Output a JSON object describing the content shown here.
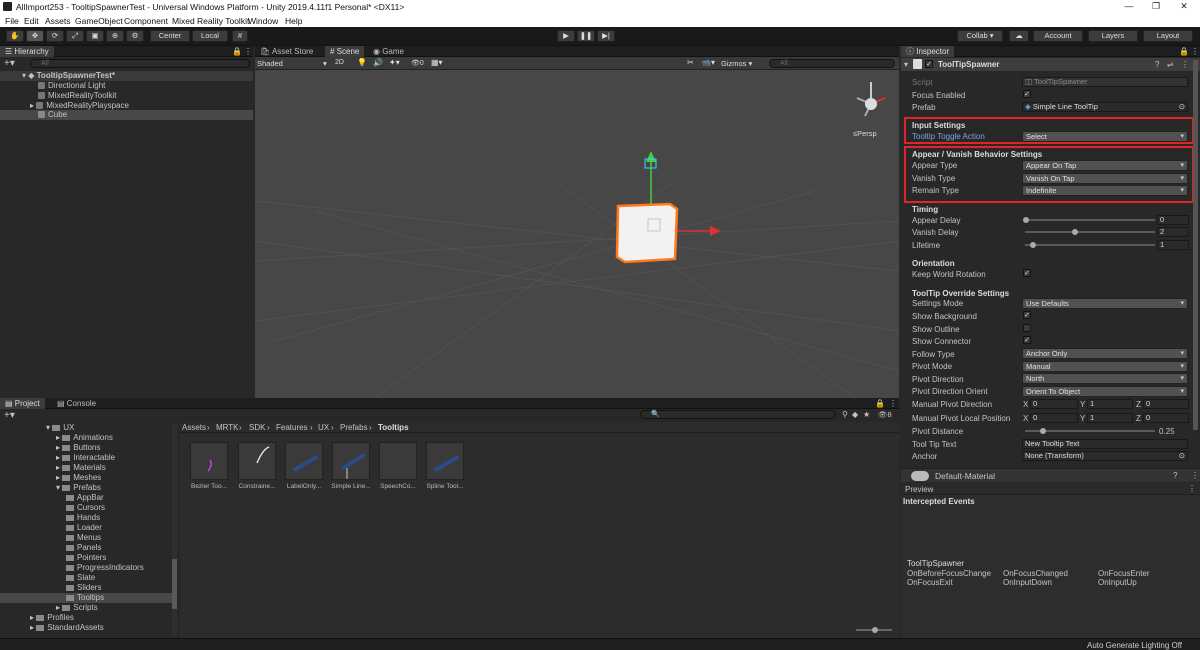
{
  "window": {
    "title": "AllImport253 - TooltipSpawnerTest - Universal Windows Platform - Unity 2019.4.11f1 Personal* <DX11>",
    "controls": [
      "—",
      "❐",
      "✕"
    ]
  },
  "menu": [
    "File",
    "Edit",
    "Assets",
    "GameObject",
    "Component",
    "Mixed Reality Toolkit",
    "Window",
    "Help"
  ],
  "toolbar": {
    "pivot_center": "Center",
    "pivot_local": "Local",
    "collab": "Collab ▾",
    "account": "Account",
    "layers": "Layers",
    "layout": "Layout"
  },
  "hierarchy": {
    "tab": "Hierarchy",
    "search_placeholder": "All",
    "scene": "TooltipSpawnerTest*",
    "items": [
      "Directional Light",
      "MixedRealityToolkit",
      "MixedRealityPlayspace",
      "Cube"
    ]
  },
  "scene_tabs": [
    "Asset Store",
    "Scene",
    "Game"
  ],
  "scene_toolbar": {
    "shading": "Shaded",
    "mode2d": "2D",
    "fx_count": "0",
    "gizmos": "Gizmos",
    "search_placeholder": "All",
    "persp": "≤Persp"
  },
  "project": {
    "tabs": [
      "Project",
      "Console"
    ],
    "breadcrumb": [
      "Assets",
      "MRTK",
      "SDK",
      "Features",
      "UX",
      "Prefabs",
      "Tooltips"
    ],
    "hidden_count": "8",
    "tree": [
      {
        "name": "UX",
        "indent": 0
      },
      {
        "name": "Animations",
        "indent": 1
      },
      {
        "name": "Buttons",
        "indent": 1
      },
      {
        "name": "Interactable",
        "indent": 1
      },
      {
        "name": "Materials",
        "indent": 1
      },
      {
        "name": "Meshes",
        "indent": 1
      },
      {
        "name": "Prefabs",
        "indent": 1
      },
      {
        "name": "AppBar",
        "indent": 2
      },
      {
        "name": "Cursors",
        "indent": 2
      },
      {
        "name": "Hands",
        "indent": 2
      },
      {
        "name": "Loader",
        "indent": 2
      },
      {
        "name": "Menus",
        "indent": 2
      },
      {
        "name": "Panels",
        "indent": 2
      },
      {
        "name": "Pointers",
        "indent": 2
      },
      {
        "name": "ProgressIndicators",
        "indent": 2
      },
      {
        "name": "Slate",
        "indent": 2
      },
      {
        "name": "Sliders",
        "indent": 2
      },
      {
        "name": "Tooltips",
        "indent": 2
      },
      {
        "name": "Scripts",
        "indent": 1
      },
      {
        "name": "Profiles",
        "indent": -1
      },
      {
        "name": "StandardAssets",
        "indent": -1
      }
    ],
    "assets": [
      "Bezier Too...",
      "Constraine...",
      "LabelOnly...",
      "Simple Line...",
      "SpeechCo...",
      "Spline Tool..."
    ]
  },
  "inspector": {
    "tab": "Inspector",
    "component": "ToolTipSpawner",
    "script_label": "Script",
    "script_value": "ToolTipSpawner",
    "focus_enabled": "Focus Enabled",
    "prefab_label": "Prefab",
    "prefab_value": "Simple Line ToolTip",
    "input_settings": "Input Settings",
    "toggle_action_label": "Tooltip Toggle Action",
    "toggle_action_value": "Select",
    "appear_vanish": "Appear / Vanish Behavior Settings",
    "appear_type_label": "Appear Type",
    "appear_type_value": "Appear On Tap",
    "vanish_type_label": "Vanish Type",
    "vanish_type_value": "Vanish On Tap",
    "remain_type_label": "Remain Type",
    "remain_type_value": "Indefinite",
    "timing": "Timing",
    "appear_delay_label": "Appear Delay",
    "appear_delay": "0",
    "vanish_delay_label": "Vanish Delay",
    "vanish_delay": "2",
    "lifetime_label": "Lifetime",
    "lifetime": "1",
    "orientation": "Orientation",
    "keep_world_rotation": "Keep World Rotation",
    "override": "ToolTip Override Settings",
    "settings_mode_label": "Settings Mode",
    "settings_mode": "Use Defaults",
    "show_background": "Show Background",
    "show_outline": "Show Outline",
    "show_connector": "Show Connector",
    "follow_type_label": "Follow Type",
    "follow_type": "Anchor Only",
    "pivot_mode_label": "Pivot Mode",
    "pivot_mode": "Manual",
    "pivot_direction_label": "Pivot Direction",
    "pivot_direction": "North",
    "pivot_orient_label": "Pivot Direction Orient",
    "pivot_orient": "Orient To Object",
    "manual_dir_label": "Manual Pivot Direction",
    "manual_dir": [
      "0",
      "1",
      "0"
    ],
    "manual_local_label": "Manual Pivot Local Position",
    "manual_local": [
      "0",
      "1",
      "0"
    ],
    "axes": [
      "X",
      "Y",
      "Z"
    ],
    "pivot_distance_label": "Pivot Distance",
    "pivot_distance": "0.25",
    "tooltip_text_label": "Tool Tip Text",
    "tooltip_text": "New Tooltip Text",
    "anchor_label": "Anchor",
    "anchor": "None (Transform)",
    "material": "Default-Material"
  },
  "preview": {
    "tab": "Preview",
    "section": "Intercepted Events",
    "component": "ToolTipSpawner",
    "events": [
      "OnBeforeFocusChange",
      "OnFocusChanged",
      "OnFocusEnter",
      "OnFocusExit",
      "OnInputDown",
      "OnInputUp"
    ]
  },
  "status": "Auto Generate Lighting Off"
}
